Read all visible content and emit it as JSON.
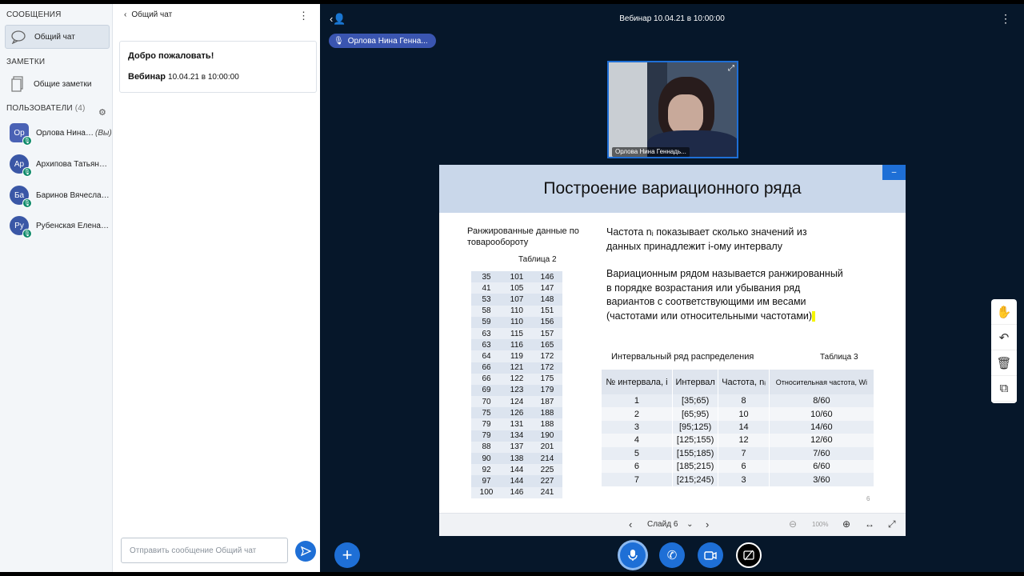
{
  "sidebar": {
    "messages_title": "СООБЩЕНИЯ",
    "public_chat_label": "Общий чат",
    "notes_title": "ЗАМЕТКИ",
    "shared_notes_label": "Общие заметки",
    "users_title": "ПОЛЬЗОВАТЕЛИ",
    "users_count": "(4)",
    "users": [
      {
        "initials": "Ор",
        "name": "Орлова Нина ...",
        "you": "(Вы)"
      },
      {
        "initials": "Ар",
        "name": "Архипова Татьяна ..."
      },
      {
        "initials": "Ба",
        "name": "Баринов Вячеслав..."
      },
      {
        "initials": "Ру",
        "name": "Рубенская Елена ..."
      }
    ]
  },
  "chat": {
    "header": "Общий чат",
    "welcome_title": "Добро пожаловать!",
    "welcome_webinar": "Вебинар",
    "welcome_datetime": "10.04.21 в 10:00:00",
    "input_placeholder": "Отправить сообщение Общий чат"
  },
  "main": {
    "title": "Вебинар 10.04.21 в 10:00:00",
    "speaker": "Орлова Нина Генна...",
    "video_label": "Орлова Нина Геннадь..."
  },
  "slide": {
    "title": "Построение вариационного ряда",
    "left_caption": "Ранжированные данные по товарообороту",
    "table2_caption": "Таблица 2",
    "table2_rows": [
      [
        "35",
        "101",
        "146"
      ],
      [
        "41",
        "105",
        "147"
      ],
      [
        "53",
        "107",
        "148"
      ],
      [
        "58",
        "110",
        "151"
      ],
      [
        "59",
        "110",
        "156"
      ],
      [
        "63",
        "115",
        "157"
      ],
      [
        "63",
        "116",
        "165"
      ],
      [
        "64",
        "119",
        "172"
      ],
      [
        "66",
        "121",
        "172"
      ],
      [
        "66",
        "122",
        "175"
      ],
      [
        "69",
        "123",
        "179"
      ],
      [
        "70",
        "124",
        "187"
      ],
      [
        "75",
        "126",
        "188"
      ],
      [
        "79",
        "131",
        "188"
      ],
      [
        "79",
        "134",
        "190"
      ],
      [
        "88",
        "137",
        "201"
      ],
      [
        "90",
        "138",
        "214"
      ],
      [
        "92",
        "144",
        "225"
      ],
      [
        "97",
        "144",
        "227"
      ],
      [
        "100",
        "146",
        "241"
      ]
    ],
    "para1": "Частота nᵢ показывает сколько значений из данных принадлежит i-ому интервалу",
    "para2": "Вариационным рядом называется ранжированный в порядке возрастания или убывания ряд вариантов с соответствующими им весами (частотами или относительными частотами)",
    "interval_caption": "Интервальный ряд распределения",
    "table3_caption": "Таблица 3",
    "table3_headers": [
      "№ интервала, i",
      "Интервал",
      "Частота, nᵢ",
      "Относительная частота, Wi"
    ],
    "table3_rows": [
      [
        "1",
        "[35;65)",
        "8",
        "8/60"
      ],
      [
        "2",
        "[65;95)",
        "10",
        "10/60"
      ],
      [
        "3",
        "[95;125)",
        "14",
        "14/60"
      ],
      [
        "4",
        "[125;155)",
        "12",
        "12/60"
      ],
      [
        "5",
        "[155;185)",
        "7",
        "7/60"
      ],
      [
        "6",
        "[185;215)",
        "6",
        "6/60"
      ],
      [
        "7",
        "[215;245)",
        "3",
        "3/60"
      ]
    ],
    "page_number": "6",
    "slide_selector": "Слайд 6",
    "zoom": "100%"
  }
}
